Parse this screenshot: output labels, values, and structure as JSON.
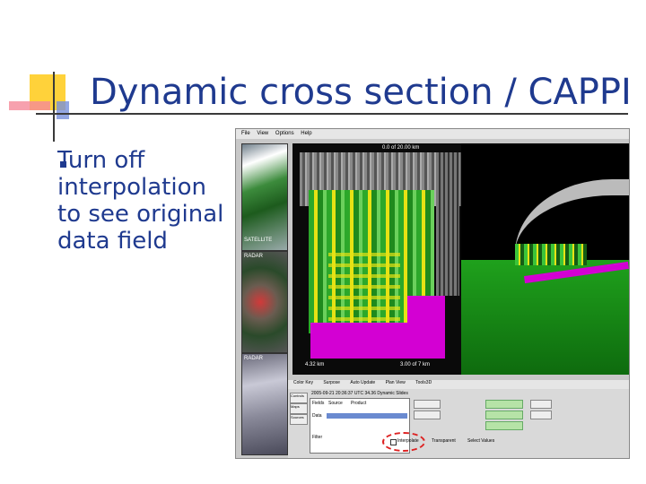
{
  "slide": {
    "title": "Dynamic cross section / CAPPI",
    "bullet": "Turn off interpolation to see original data field"
  },
  "app": {
    "menu": [
      "File",
      "View",
      "Options",
      "Help"
    ],
    "thumbs": [
      {
        "label": "SATELLITE"
      },
      {
        "label": "RADAR"
      },
      {
        "label": "RADAR"
      }
    ],
    "cross_section": {
      "top_readout": "0.0 of 20.00 km",
      "bottom_left": "4.32 km",
      "bottom_right": "3.00 of 7 km"
    },
    "control_panel": {
      "tabs": [
        "Color Key",
        "Surpose",
        "Auto Update",
        "Plan View",
        "Tools3D"
      ],
      "left_buttons": [
        "Controls",
        "Maps",
        "Sources"
      ],
      "time_text": "2005-09-21 20:36:37 UTC 34.36 Dynamic Slides",
      "row_labels": [
        "Fields",
        "Data",
        "Filter"
      ],
      "col_headers": [
        "Source",
        "Product"
      ],
      "interpolate_label": "Interpolate",
      "transparent_label": "Transparent",
      "select_label": "Select Values"
    },
    "colors": {
      "title": "#1f3a8f",
      "purple": "#d300d3",
      "green": "#22b41e",
      "yellow": "#e6e214"
    }
  }
}
